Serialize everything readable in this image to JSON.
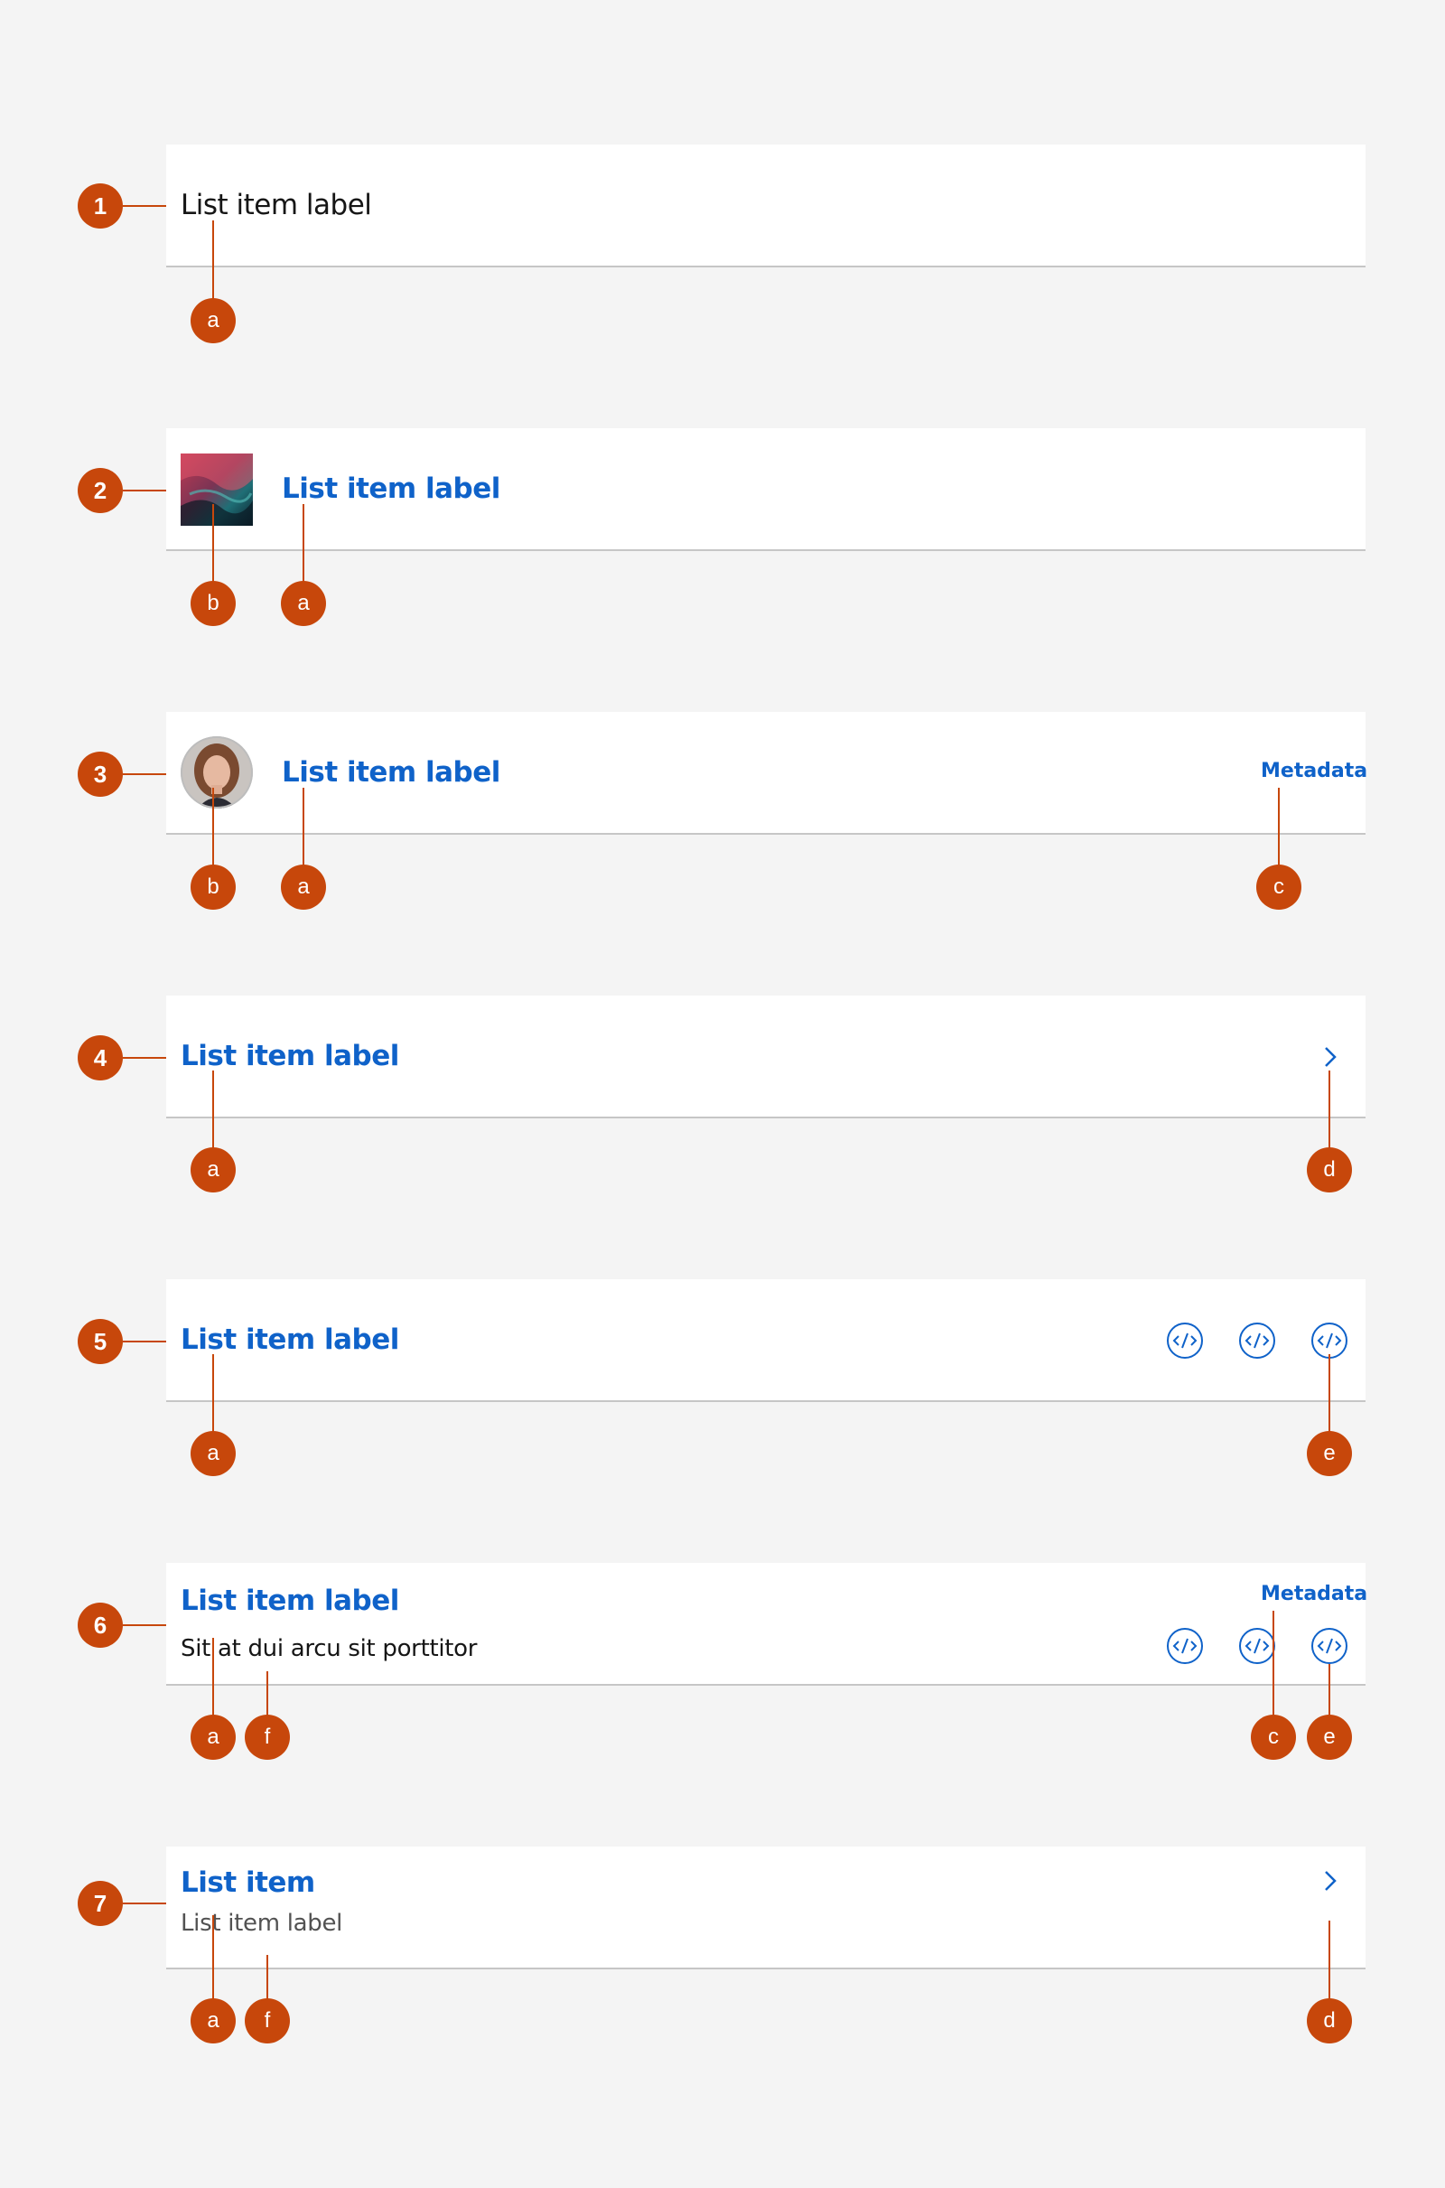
{
  "rows": [
    {
      "number": "1",
      "label": "List item label",
      "callouts": [
        "a"
      ]
    },
    {
      "number": "2",
      "label": "List item label",
      "callouts": [
        "b",
        "a"
      ],
      "leading": "thumbnail-image"
    },
    {
      "number": "3",
      "label": "List item label",
      "metadata": "Metadata",
      "callouts": [
        "b",
        "a",
        "c"
      ],
      "leading": "avatar-image"
    },
    {
      "number": "4",
      "label": "List item label",
      "trailing": "chevron-right-icon",
      "callouts": [
        "a",
        "d"
      ]
    },
    {
      "number": "5",
      "label": "List item label",
      "trailing": [
        "code-icon",
        "code-icon",
        "code-icon"
      ],
      "callouts": [
        "a",
        "e"
      ]
    },
    {
      "number": "6",
      "label": "List item label",
      "description": "Sit at dui arcu sit porttitor",
      "metadata": "Metadata",
      "trailing": [
        "code-icon",
        "code-icon",
        "code-icon"
      ],
      "callouts": [
        "a",
        "f",
        "c",
        "e"
      ]
    },
    {
      "number": "7",
      "label": "List item",
      "description": "List item label",
      "trailing": "chevron-right-icon",
      "callouts": [
        "a",
        "f",
        "d"
      ]
    }
  ],
  "colors": {
    "accent": "#0f62c9",
    "callout": "#c7470b",
    "text": "#161616",
    "secondary_text": "#525252",
    "divider": "#c6c6c6",
    "background": "#f4f4f4"
  }
}
